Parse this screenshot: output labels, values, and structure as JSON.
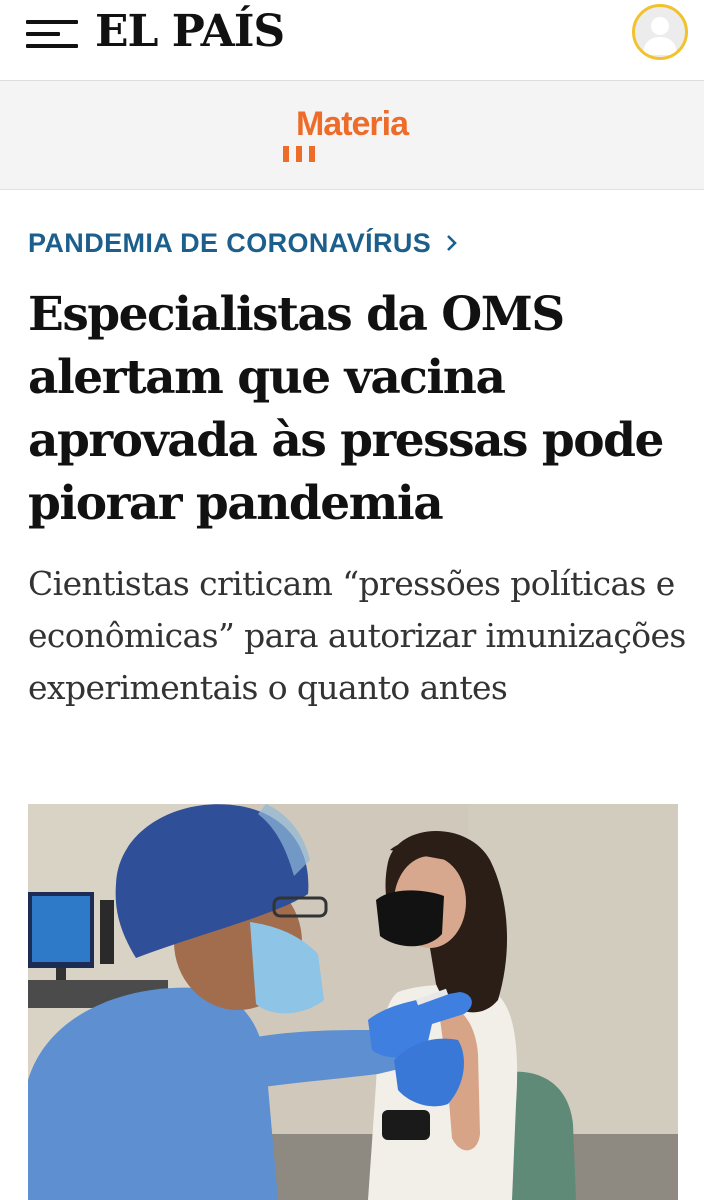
{
  "header": {
    "logo_text": "EL PAÍS",
    "menu_icon": "hamburger-menu-icon",
    "avatar_icon": "user-avatar-icon",
    "avatar_ring_color": "#f2c12e"
  },
  "section": {
    "name": "Materia",
    "color": "#ee6c2a"
  },
  "article": {
    "kicker": "PANDEMIA DE CORONAVÍRUS",
    "kicker_icon": "chevron-right-icon",
    "kicker_color": "#1c5f8c",
    "headline": "Especialistas da OMS alertam que vacina aprovada às pressas pode piorar pandemia",
    "subheadline": "Cientistas criticam “pressões políticas e econômicas” para autorizar imunizações experimentais o quanto antes",
    "photo_icon": "article-photo"
  }
}
